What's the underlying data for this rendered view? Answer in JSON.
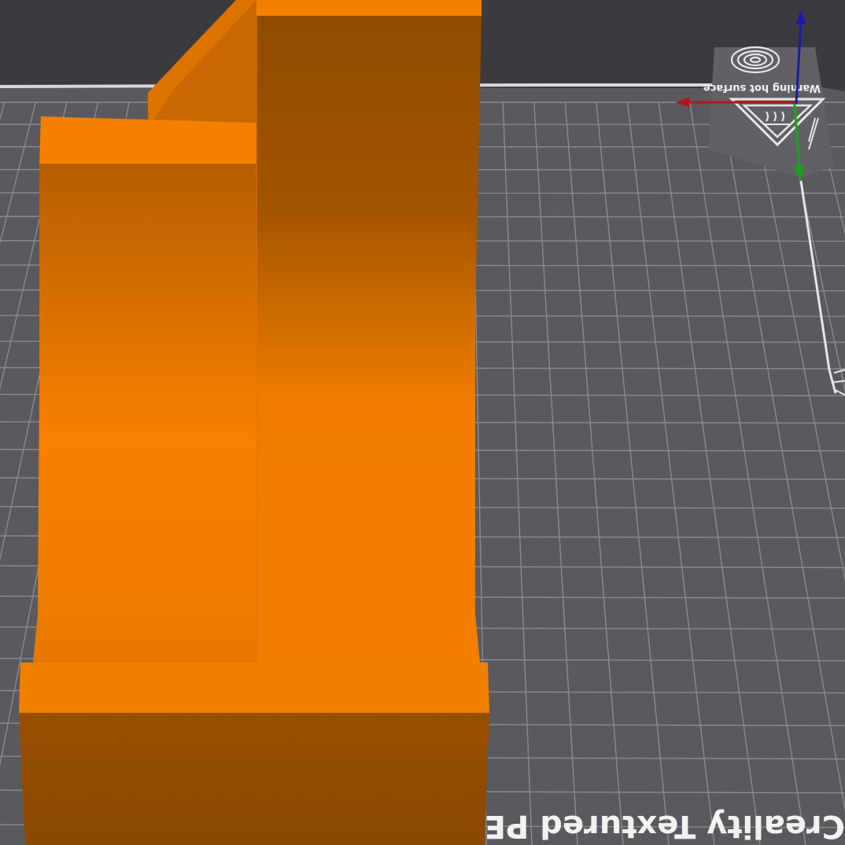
{
  "viewport": {
    "name": "3D slicer build plate view",
    "background_color": "#3b3b3f",
    "bed_color": "#5a5a5e",
    "grid_color": "#8b8b90",
    "model_color": "#f57f00"
  },
  "bed": {
    "warning_label": "Warning hot surface",
    "plate_label": "Creality Textured PE",
    "icons": [
      "fingerprint-icon",
      "hot-surface-warning-icon",
      "bed-clip-icon"
    ]
  },
  "axes": {
    "x_color": "#b01818",
    "y_color": "#16a51a",
    "z_color": "#1a1aa8"
  },
  "model": {
    "name": "orange printed part"
  }
}
